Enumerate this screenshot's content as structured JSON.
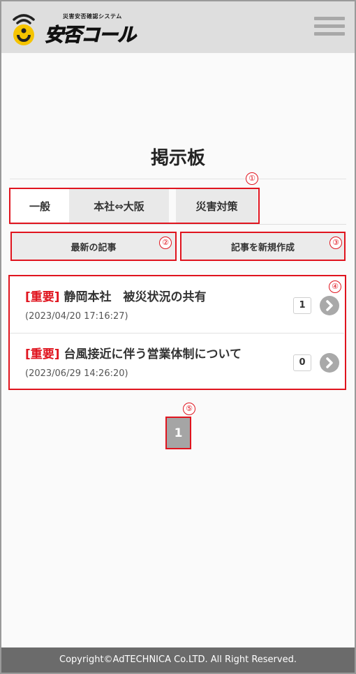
{
  "header": {
    "logo_subtitle": "災害安否確認システム",
    "logo_title": "安否コール"
  },
  "page_title": "掲示板",
  "annotations": [
    "①",
    "②",
    "③",
    "④",
    "⑤"
  ],
  "tabs": [
    {
      "label": "一般",
      "active": true
    },
    {
      "label": "本社⇔大阪",
      "active": false
    },
    {
      "label": "災害対策",
      "active": false
    }
  ],
  "actions": {
    "latest_label": "最新の記事",
    "new_post_label": "記事を新規作成"
  },
  "posts": [
    {
      "tag": "[重要]",
      "title": "静岡本社　被災状況の共有",
      "date": "(2023/04/20 17:16:27)",
      "count": "1"
    },
    {
      "tag": "[重要]",
      "title": "台風接近に伴う営業体制について",
      "date": "(2023/06/29 14:26:20)",
      "count": "0"
    }
  ],
  "pagination": {
    "current": "1"
  },
  "footer": {
    "copyright": "Copyright©AdTECHNICA Co.LTD. All Right Reserved."
  },
  "colors": {
    "accent_red": "#e0141e",
    "logo_yellow": "#f5c400",
    "header_bg": "#dedede",
    "footer_bg": "#6b6b6b"
  }
}
